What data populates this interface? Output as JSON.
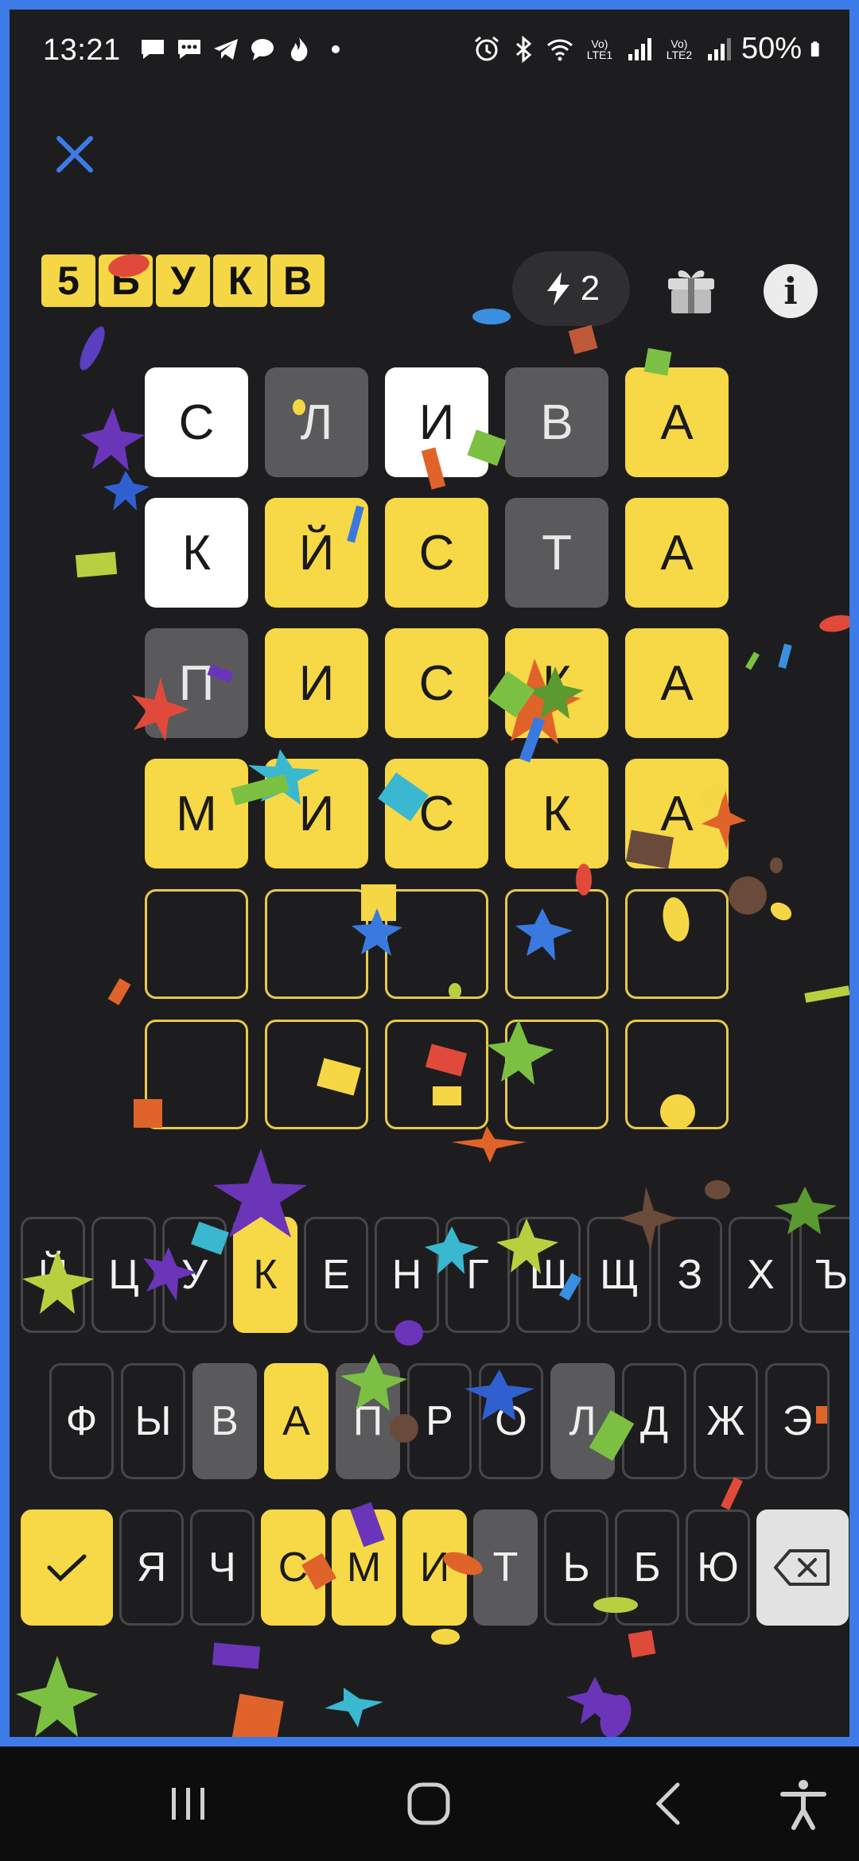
{
  "status_bar": {
    "time": "13:21",
    "battery": "50%",
    "sim1": "Vo) LTE1",
    "sim2": "Vo) LTE2",
    "left_icons": [
      "chat-bubble-icon",
      "chat-dots-icon",
      "telegram-icon",
      "chat-bubble-icon",
      "flame-icon",
      "dot-icon"
    ],
    "right_icons": [
      "alarm-icon",
      "bluetooth-icon",
      "wifi-icon",
      "signal-icon",
      "signal-icon",
      "battery-icon"
    ]
  },
  "header": {
    "logo_letters": [
      "5",
      "Б",
      "У",
      "К",
      "В"
    ],
    "energy_count": "2",
    "info_label": "i"
  },
  "board": {
    "rows": [
      [
        {
          "l": "С",
          "s": "white"
        },
        {
          "l": "Л",
          "s": "gray"
        },
        {
          "l": "И",
          "s": "white"
        },
        {
          "l": "В",
          "s": "gray"
        },
        {
          "l": "А",
          "s": "yellow"
        }
      ],
      [
        {
          "l": "К",
          "s": "white"
        },
        {
          "l": "Й",
          "s": "yellow"
        },
        {
          "l": "С",
          "s": "yellow"
        },
        {
          "l": "Т",
          "s": "gray"
        },
        {
          "l": "А",
          "s": "yellow"
        }
      ],
      [
        {
          "l": "П",
          "s": "gray"
        },
        {
          "l": "И",
          "s": "yellow"
        },
        {
          "l": "С",
          "s": "yellow"
        },
        {
          "l": "К",
          "s": "yellow"
        },
        {
          "l": "А",
          "s": "yellow"
        }
      ],
      [
        {
          "l": "М",
          "s": "yellow"
        },
        {
          "l": "И",
          "s": "yellow"
        },
        {
          "l": "С",
          "s": "yellow"
        },
        {
          "l": "К",
          "s": "yellow"
        },
        {
          "l": "А",
          "s": "yellow"
        }
      ],
      [
        {
          "l": "",
          "s": "empty"
        },
        {
          "l": "",
          "s": "empty"
        },
        {
          "l": "",
          "s": "empty"
        },
        {
          "l": "",
          "s": "empty"
        },
        {
          "l": "",
          "s": "empty"
        }
      ],
      [
        {
          "l": "",
          "s": "empty"
        },
        {
          "l": "",
          "s": "empty"
        },
        {
          "l": "",
          "s": "empty"
        },
        {
          "l": "",
          "s": "empty"
        },
        {
          "l": "",
          "s": "empty"
        }
      ]
    ]
  },
  "keyboard": {
    "row1": [
      {
        "l": "Й",
        "s": "none"
      },
      {
        "l": "Ц",
        "s": "none"
      },
      {
        "l": "У",
        "s": "none"
      },
      {
        "l": "К",
        "s": "yellow"
      },
      {
        "l": "Е",
        "s": "none"
      },
      {
        "l": "Н",
        "s": "none"
      },
      {
        "l": "Г",
        "s": "none"
      },
      {
        "l": "Ш",
        "s": "none"
      },
      {
        "l": "Щ",
        "s": "none"
      },
      {
        "l": "З",
        "s": "none"
      },
      {
        "l": "Х",
        "s": "none"
      },
      {
        "l": "Ъ",
        "s": "none"
      }
    ],
    "row2": [
      {
        "l": "Ф",
        "s": "none"
      },
      {
        "l": "Ы",
        "s": "none"
      },
      {
        "l": "В",
        "s": "gray"
      },
      {
        "l": "А",
        "s": "yellow"
      },
      {
        "l": "П",
        "s": "gray"
      },
      {
        "l": "Р",
        "s": "none"
      },
      {
        "l": "О",
        "s": "none"
      },
      {
        "l": "Л",
        "s": "gray"
      },
      {
        "l": "Д",
        "s": "none"
      },
      {
        "l": "Ж",
        "s": "none"
      },
      {
        "l": "Э",
        "s": "none"
      }
    ],
    "row3": [
      {
        "l": "Я",
        "s": "none"
      },
      {
        "l": "Ч",
        "s": "none"
      },
      {
        "l": "С",
        "s": "yellow"
      },
      {
        "l": "М",
        "s": "yellow"
      },
      {
        "l": "И",
        "s": "yellow"
      },
      {
        "l": "Т",
        "s": "gray"
      },
      {
        "l": "Ь",
        "s": "none"
      },
      {
        "l": "Б",
        "s": "none"
      },
      {
        "l": "Ю",
        "s": "none"
      }
    ],
    "submit_icon": "checkmark-icon",
    "delete_icon": "backspace-icon"
  },
  "colors": {
    "accent_blue": "#3d7be8",
    "yellow": "#f7d846",
    "gray_tile": "#5a5a5c",
    "background": "#1d1d1f"
  },
  "nav_bar": {
    "icons": [
      "recent-apps-icon",
      "home-icon",
      "back-icon",
      "accessibility-icon"
    ]
  }
}
